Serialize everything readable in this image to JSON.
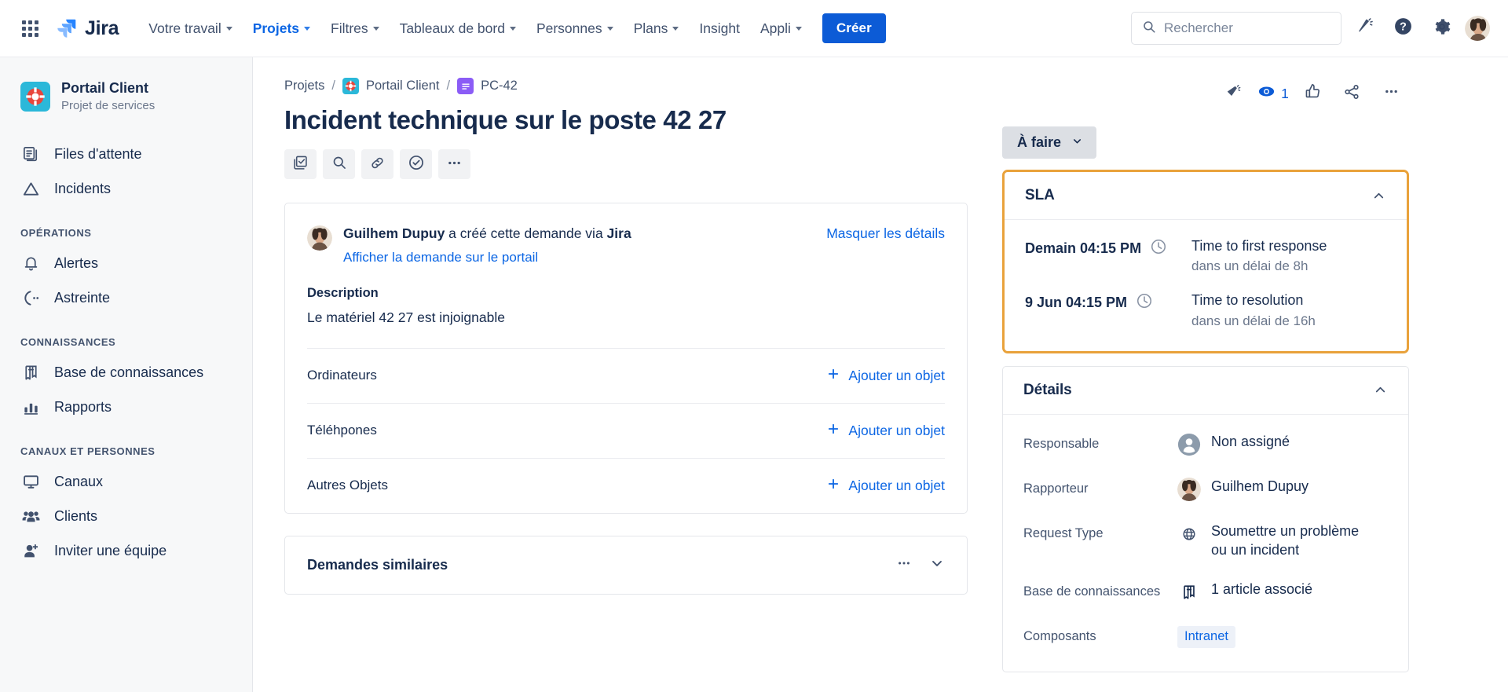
{
  "topnav": {
    "app_switcher_icon": "grid-apps-icon",
    "brand": "Jira",
    "items": [
      {
        "label": "Votre travail",
        "has_caret": true,
        "active": false
      },
      {
        "label": "Projets",
        "has_caret": true,
        "active": true
      },
      {
        "label": "Filtres",
        "has_caret": true,
        "active": false
      },
      {
        "label": "Tableaux de bord",
        "has_caret": true,
        "active": false
      },
      {
        "label": "Personnes",
        "has_caret": true,
        "active": false
      },
      {
        "label": "Plans",
        "has_caret": true,
        "active": false
      },
      {
        "label": "Insight",
        "has_caret": false,
        "active": false
      },
      {
        "label": "Appli",
        "has_caret": true,
        "active": false
      }
    ],
    "create_label": "Créer",
    "search_placeholder": "Rechercher",
    "search_value": "",
    "icons": [
      "notifications-bell-icon",
      "help-question-icon",
      "settings-gear-icon",
      "user-avatar"
    ]
  },
  "sidebar": {
    "project_name": "Portail Client",
    "project_type": "Projet de services",
    "project_icon": "lifebuoy-icon",
    "primary_items": [
      {
        "label": "Files d'attente",
        "icon": "queues-icon"
      },
      {
        "label": "Incidents",
        "icon": "incident-triangle-icon"
      }
    ],
    "sections": [
      {
        "label": "OPÉRATIONS",
        "items": [
          {
            "label": "Alertes",
            "icon": "bell-icon"
          },
          {
            "label": "Astreinte",
            "icon": "on-call-phone-icon"
          }
        ]
      },
      {
        "label": "CONNAISSANCES",
        "items": [
          {
            "label": "Base de connaissances",
            "icon": "book-icon"
          },
          {
            "label": "Rapports",
            "icon": "bar-chart-icon"
          }
        ]
      },
      {
        "label": "CANAUX ET PERSONNES",
        "items": [
          {
            "label": "Canaux",
            "icon": "monitor-icon"
          },
          {
            "label": "Clients",
            "icon": "people-group-icon"
          },
          {
            "label": "Inviter une équipe",
            "icon": "add-person-icon"
          }
        ]
      }
    ]
  },
  "breadcrumb": {
    "projects": "Projets",
    "project": "Portail Client",
    "issue_key": "PC-42",
    "separator": "/"
  },
  "issue": {
    "title": "Incident technique sur le poste 42 27",
    "actions": [
      {
        "icon": "subtask-checkbox-icon",
        "name": "add-child-item"
      },
      {
        "icon": "search-icon",
        "name": "find-issue"
      },
      {
        "icon": "link-icon",
        "name": "link-issue"
      },
      {
        "icon": "approve-check-circle-icon",
        "name": "approve"
      },
      {
        "icon": "more-horizontal-icon",
        "name": "more-actions"
      }
    ]
  },
  "request_panel": {
    "creator_name": "Guilhem Dupuy",
    "creator_text_mid": " a créé cette demande via ",
    "creator_channel": "Jira",
    "portal_link": "Afficher la demande sur le portail",
    "hide_details": "Masquer les détails",
    "description_label": "Description",
    "description_text": "Le matériel 42 27 est injoignable",
    "object_rows": [
      {
        "label": "Ordinateurs",
        "action": "Ajouter un objet"
      },
      {
        "label": "Téléhpones",
        "action": "Ajouter un objet"
      },
      {
        "label": "Autres Objets",
        "action": "Ajouter un objet"
      }
    ]
  },
  "similar_requests": {
    "title": "Demandes similaires",
    "more_icon": "more-horizontal-icon",
    "collapse_icon": "chevron-down-icon"
  },
  "issue_actions": {
    "feedback_icon": "megaphone-icon",
    "watch_icon": "watch-eye-icon",
    "watch_count": "1",
    "vote_icon": "thumbs-up-icon",
    "share_icon": "share-icon",
    "more_icon": "more-horizontal-icon"
  },
  "status": {
    "label": "À faire",
    "caret_icon": "chevron-down-icon"
  },
  "sla": {
    "panel_title": "SLA",
    "collapse_icon": "chevron-up-icon",
    "rows": [
      {
        "time": "Demain 04:15 PM",
        "clock_icon": "clock-icon",
        "name": "Time to first response",
        "goal": "dans un délai de 8h"
      },
      {
        "time": "9 Jun 04:15 PM",
        "clock_icon": "clock-icon",
        "name": "Time to resolution",
        "goal": "dans un délai de 16h"
      }
    ]
  },
  "details": {
    "panel_title": "Détails",
    "collapse_icon": "chevron-up-icon",
    "rows": [
      {
        "label": "Responsable",
        "value": "Non assigné",
        "icon": "default-avatar-icon"
      },
      {
        "label": "Rapporteur",
        "value": "Guilhem Dupuy",
        "icon": "user-avatar"
      },
      {
        "label": "Request Type",
        "value": "Soumettre un problème ou un incident",
        "icon": "request-type-globe-icon"
      },
      {
        "label": "Base de connaissances",
        "value": "1 article associé",
        "icon": "book-icon"
      },
      {
        "label": "Composants",
        "value": "Intranet",
        "icon": "none"
      }
    ]
  },
  "colors": {
    "brand_blue": "#0C5BD6",
    "link_blue": "#0C66E4",
    "text_dark": "#172B4D",
    "text_subtle": "#6B778C",
    "sla_highlight_orange": "#E9A23B",
    "project_avatar_cyan": "#2BB8D9",
    "issue_type_purple": "#8B5CF6",
    "status_grey": "#DCDFE4"
  }
}
